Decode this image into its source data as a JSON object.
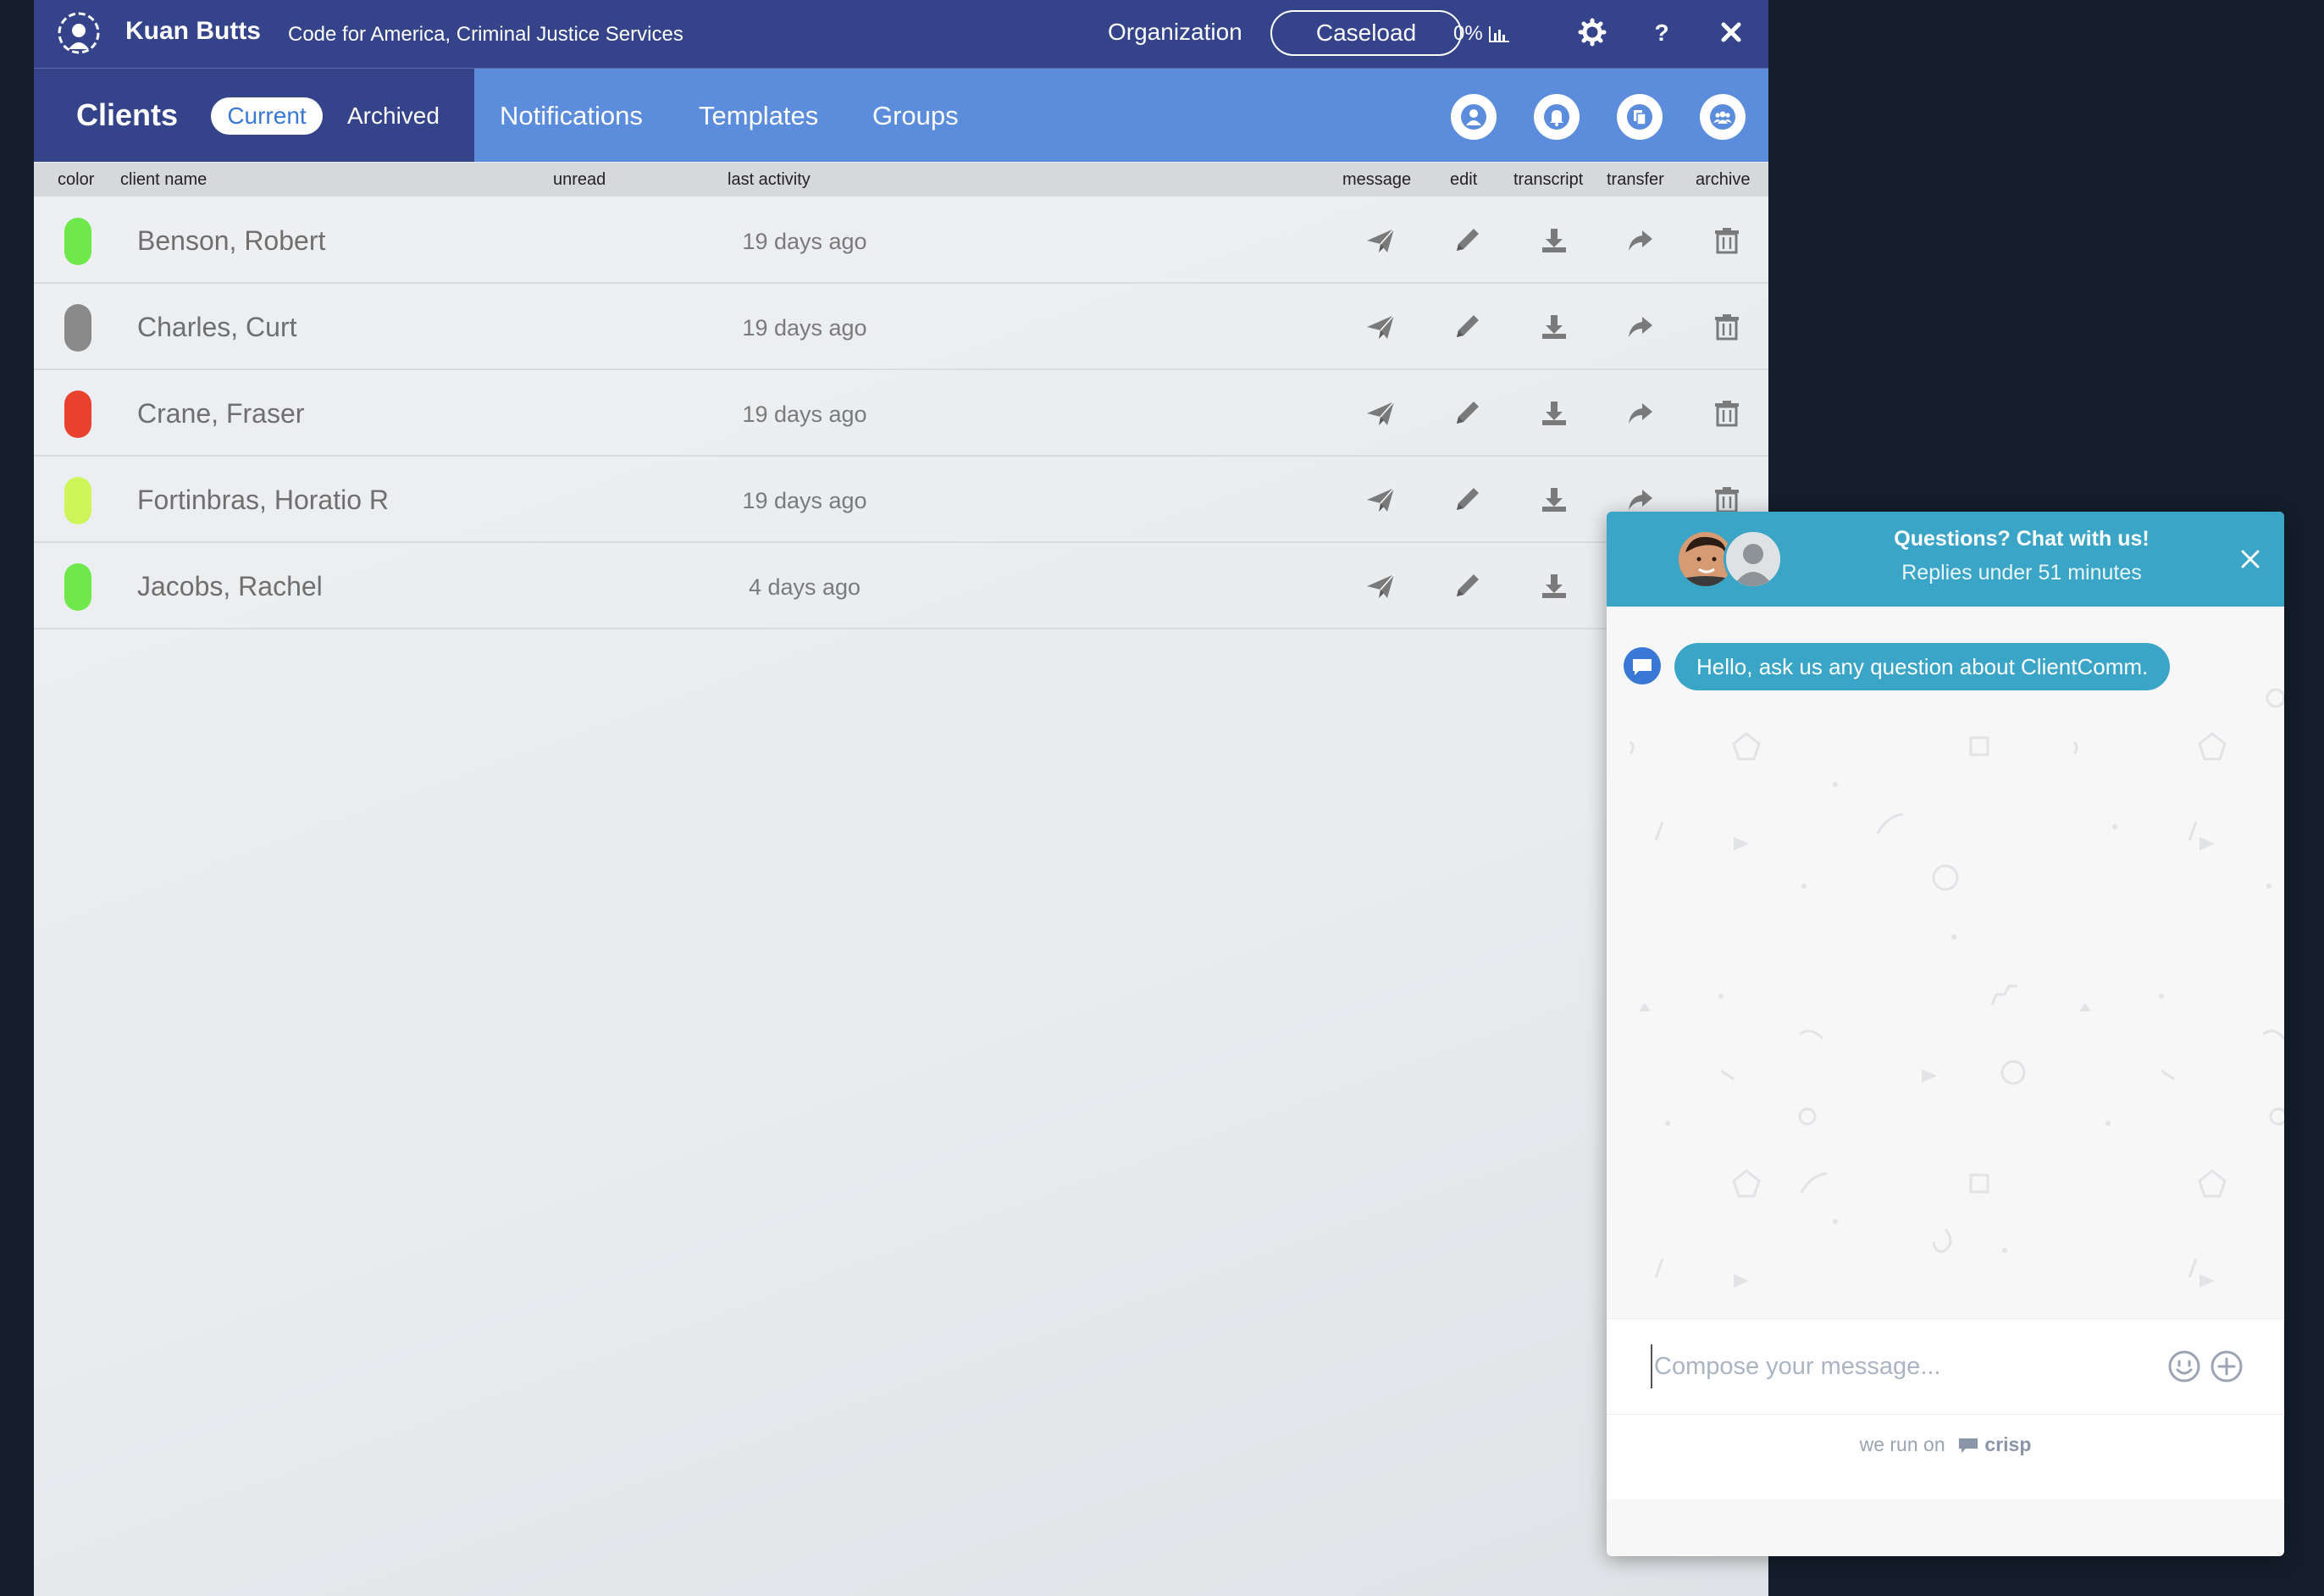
{
  "topbar": {
    "user_name": "Kuan Butts",
    "org_name": "Code for America, Criminal Justice Services",
    "organization_label": "Organization",
    "caseload_label": "Caseload",
    "percent": "0%"
  },
  "nav": {
    "clients_title": "Clients",
    "current_label": "Current",
    "archived_label": "Archived",
    "notifications_label": "Notifications",
    "templates_label": "Templates",
    "groups_label": "Groups"
  },
  "table": {
    "headers": {
      "color": "color",
      "client_name": "client name",
      "unread": "unread",
      "last_activity": "last activity",
      "message": "message",
      "edit": "edit",
      "transcript": "transcript",
      "transfer": "transfer",
      "archive": "archive"
    },
    "rows": [
      {
        "name": "Benson, Robert",
        "activity": "19 days ago",
        "color": "#6ee84a"
      },
      {
        "name": "Charles, Curt",
        "activity": "19 days ago",
        "color": "#8a8a8a"
      },
      {
        "name": "Crane, Fraser",
        "activity": "19 days ago",
        "color": "#e8412e"
      },
      {
        "name": "Fortinbras, Horatio R",
        "activity": "19 days ago",
        "color": "#cdf55a"
      },
      {
        "name": "Jacobs, Rachel",
        "activity": "4 days ago",
        "color": "#6ee84a"
      }
    ]
  },
  "chat": {
    "title": "Questions? Chat with us!",
    "subtitle": "Replies under 51 minutes",
    "greeting": "Hello, ask us any question about ClientComm.",
    "compose_placeholder": "Compose your message...",
    "footer_prefix": "we run on",
    "footer_brand": "crisp"
  },
  "colors": {
    "topbar": "#35438a",
    "nav_blue": "#5b8ddc",
    "chat_accent": "#3aa5c6"
  }
}
